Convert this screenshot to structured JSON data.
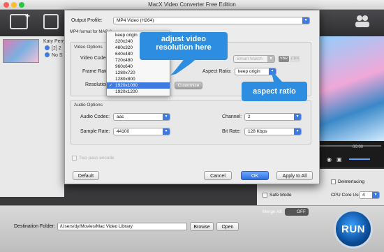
{
  "app": {
    "title": "MacX Video Converter Free Edition",
    "file_item": {
      "name": "Katy Perry",
      "line2": "[2] 2",
      "line3": "No S"
    },
    "player_time": "00:00",
    "deinterlacing_label": "Deinterlacing",
    "safe_mode_label": "Safe Mode",
    "cpu_core_label": "CPU Core Use",
    "cpu_core_value": "4",
    "merge_all_label": "Merge All:",
    "merge_toggle": "OFF",
    "destination_label": "Destination Folder:",
    "destination_value": "/Users/dy/Movies/Mac Video Library",
    "browse_label": "Browse",
    "open_label": "Open",
    "run_label": "RUN"
  },
  "dialog": {
    "output_profile_label": "Output Profile:",
    "output_profile_value": "MP4 Video (H264)",
    "format_note": "MP4 format for MAC & ...",
    "video_options_title": "Video Options",
    "video_codec_label": "Video Codec:",
    "frame_rate_label": "Frame Rate:",
    "resolution_label": "Resolution:",
    "smart_match": "Smart Match",
    "vbr": "VBR",
    "cbr": "CBR",
    "aspect_ratio_label": "Aspect Ratio:",
    "aspect_ratio_value": "keep origin",
    "customize_label": "Customize",
    "resolution_options": [
      "keep origin",
      "320x240",
      "480x320",
      "640x480",
      "720x480",
      "960x640",
      "1280x720",
      "1280x800",
      "1920x1080",
      "1920x1200"
    ],
    "resolution_selected": "1920x1080",
    "audio_options_title": "Audio Options",
    "audio_codec_label": "Audio Codec:",
    "audio_codec_value": "aac",
    "sample_rate_label": "Sample Rate:",
    "sample_rate_value": "44100",
    "channel_label": "Channel:",
    "channel_value": "2",
    "bit_rate_label": "Bit Rate:",
    "bit_rate_value": "128 Kbps",
    "two_pass_label": "Two pass encode",
    "default_label": "Default",
    "cancel_label": "Cancel",
    "ok_label": "OK",
    "apply_all_label": "Apply to All"
  },
  "callouts": {
    "resolution_line1": "adjust video",
    "resolution_line2": "resolution here",
    "aspect": "aspect ratio"
  },
  "colors": {
    "accent": "#3f7ae0",
    "callout": "#2d8de0",
    "run": "#0a4d9a"
  }
}
